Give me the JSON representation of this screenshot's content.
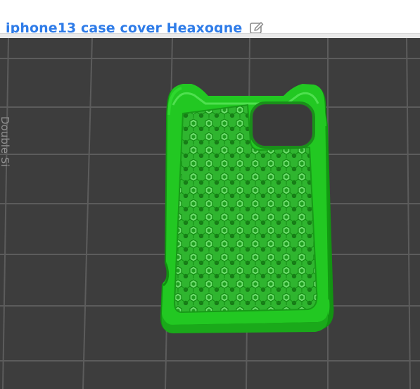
{
  "project": {
    "title": "iphone13 case cover Heaxogne",
    "edit_icon": "pencil-edit-icon"
  },
  "viewport": {
    "side_label": "Double Si",
    "model_color": "#22c822",
    "grid_color": "#5a5a5a",
    "bed_color": "#3d3d3d"
  }
}
